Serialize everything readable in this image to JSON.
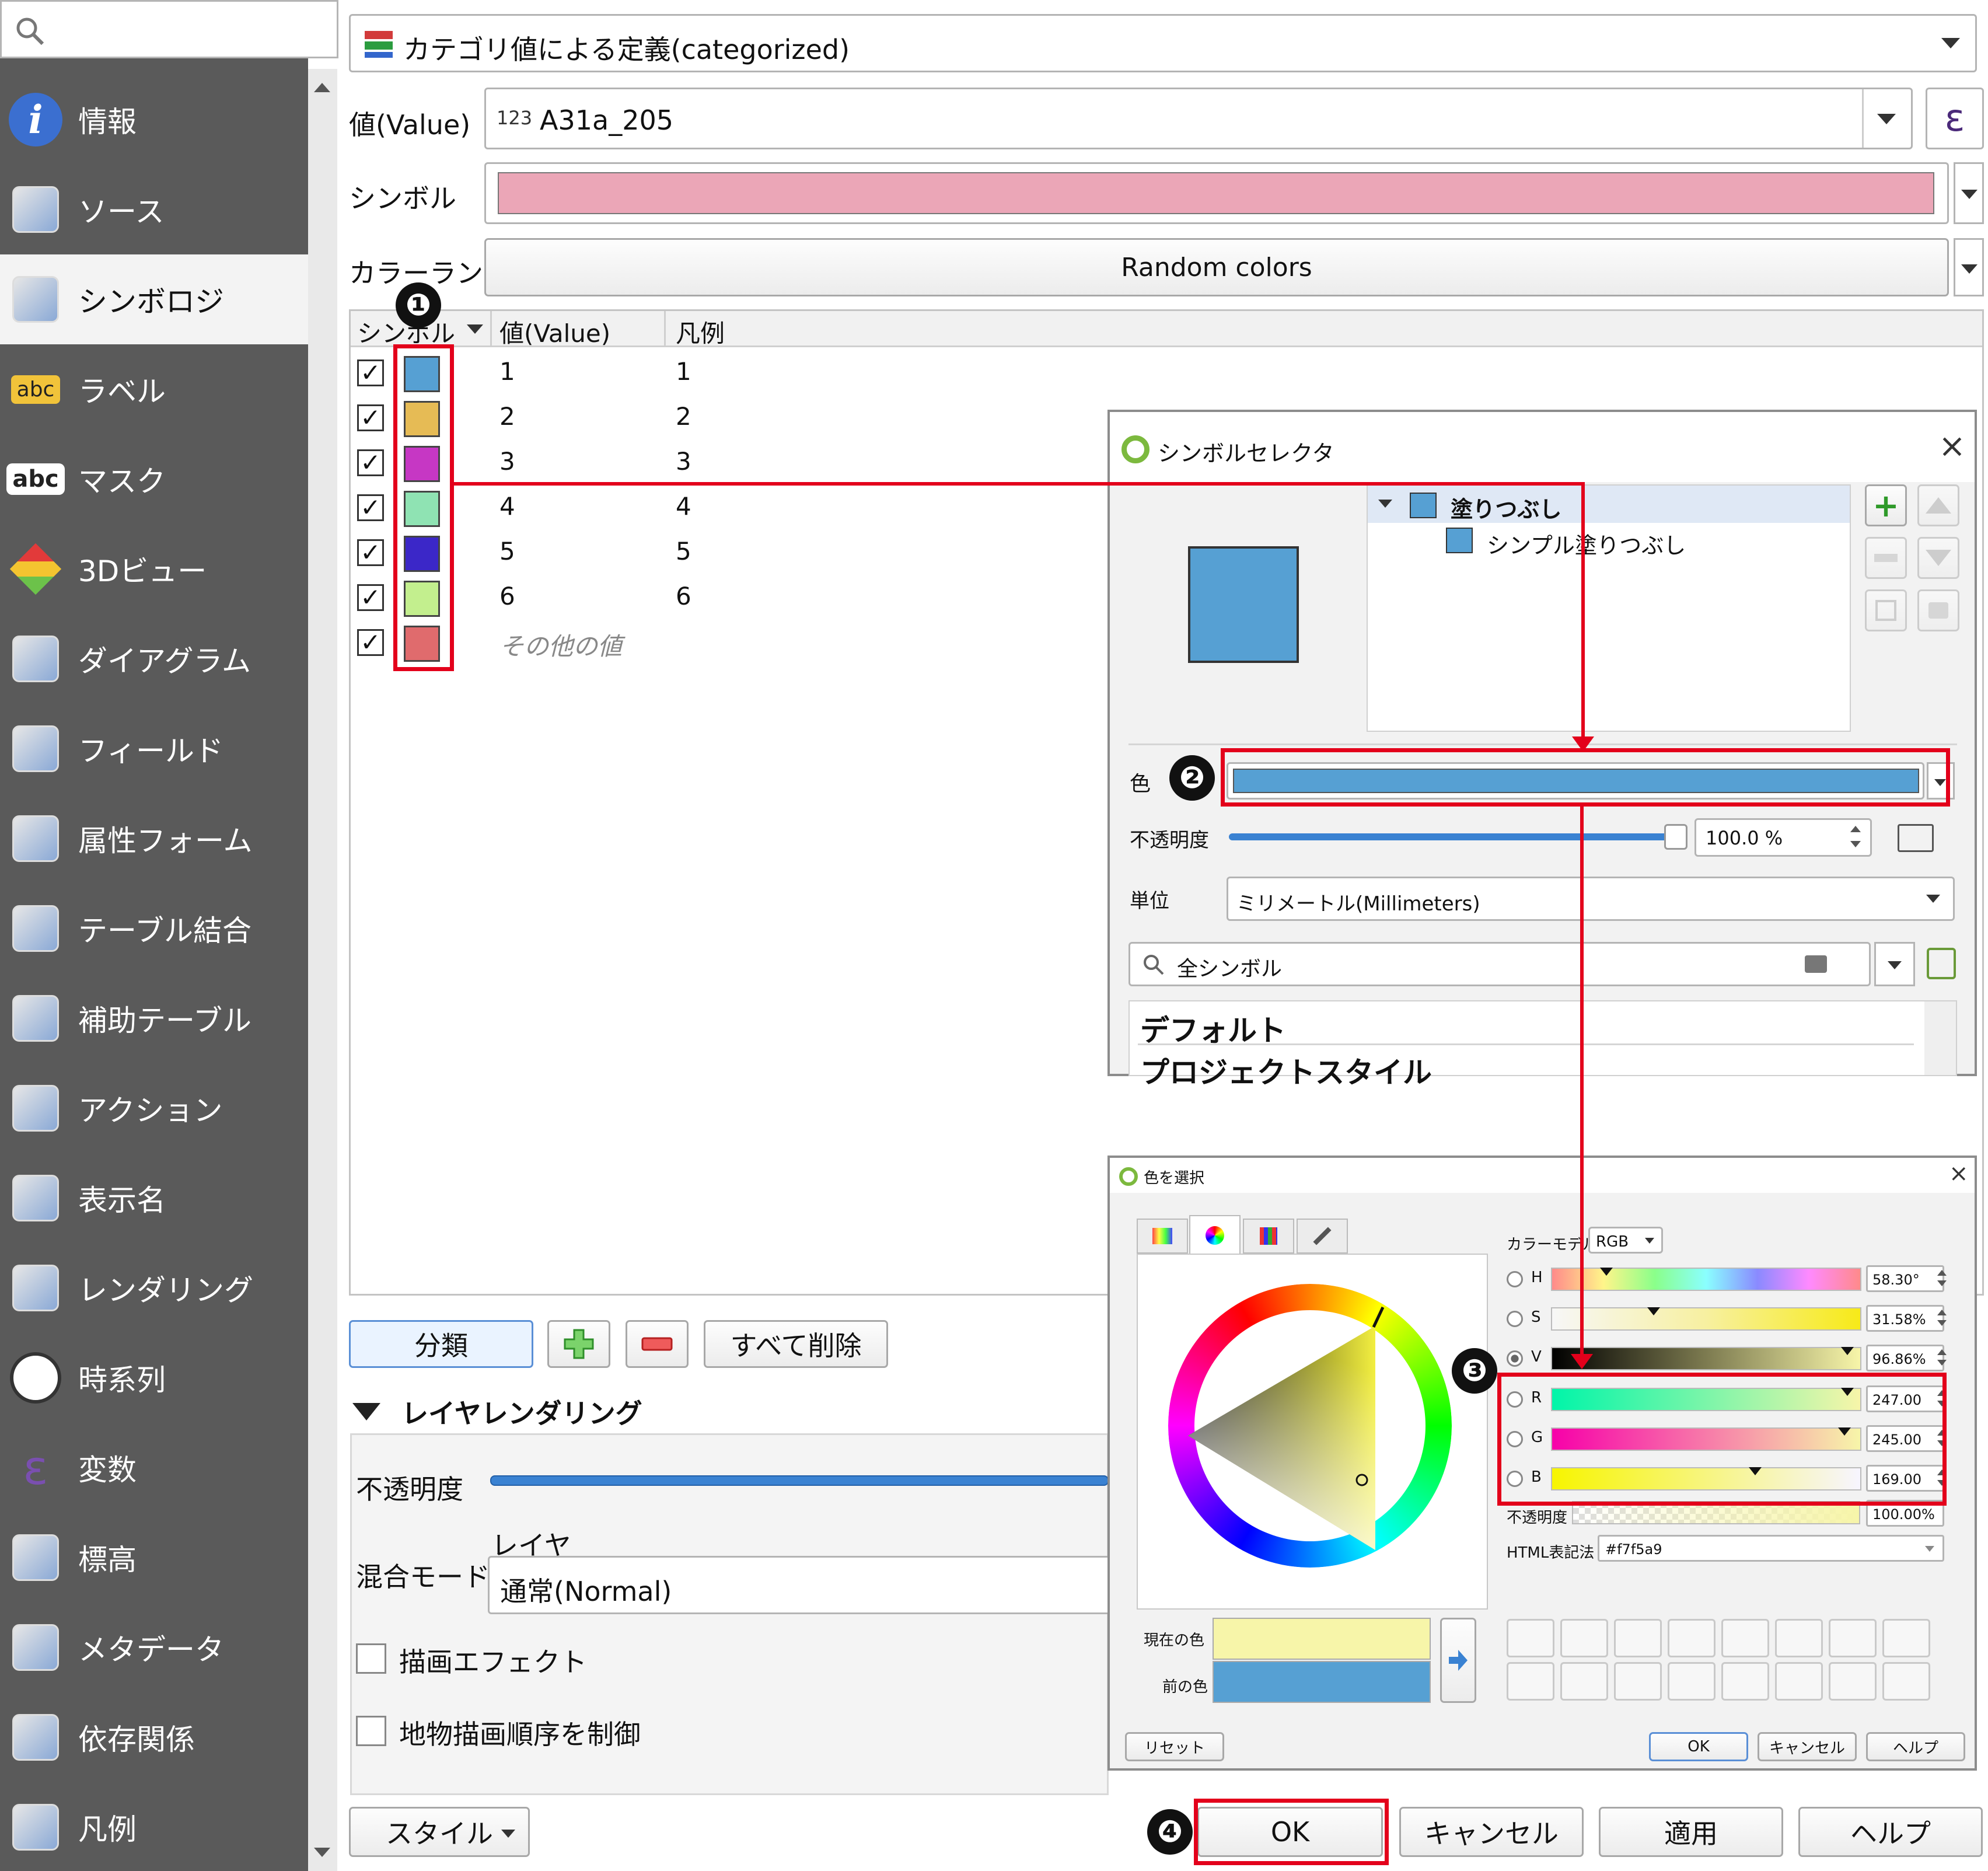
{
  "sidebar": {
    "search_icon": "search-icon",
    "items": [
      {
        "label": "情報",
        "icon": "info-icon"
      },
      {
        "label": "ソース",
        "icon": "source-tools-icon"
      },
      {
        "label": "シンボロジ",
        "icon": "symbology-brush-icon"
      },
      {
        "label": "ラベル",
        "icon": "label-abc-icon"
      },
      {
        "label": "マスク",
        "icon": "mask-abc-icon"
      },
      {
        "label": "3Dビュー",
        "icon": "cube-3d-icon"
      },
      {
        "label": "ダイアグラム",
        "icon": "diagram-icon"
      },
      {
        "label": "フィールド",
        "icon": "fields-icon"
      },
      {
        "label": "属性フォーム",
        "icon": "attribute-form-icon"
      },
      {
        "label": "テーブル結合",
        "icon": "join-icon"
      },
      {
        "label": "補助テーブル",
        "icon": "auxiliary-storage-icon"
      },
      {
        "label": "アクション",
        "icon": "action-gear-icon"
      },
      {
        "label": "表示名",
        "icon": "display-balloon-icon"
      },
      {
        "label": "レンダリング",
        "icon": "rendering-brush-icon"
      },
      {
        "label": "時系列",
        "icon": "clock-icon"
      },
      {
        "label": "変数",
        "icon": "variable-epsilon-icon"
      },
      {
        "label": "標高",
        "icon": "elevation-icon"
      },
      {
        "label": "メタデータ",
        "icon": "metadata-icon"
      },
      {
        "label": "依存関係",
        "icon": "dependencies-icon"
      },
      {
        "label": "凡例",
        "icon": "legend-icon"
      }
    ]
  },
  "renderer": {
    "label": "カテゴリ値による定義(categorized)"
  },
  "value_row": {
    "label": "値(Value)",
    "field_type": "123",
    "field": "A31a_205",
    "epsilon": "ε"
  },
  "symbol_row": {
    "label": "シンボル",
    "color": "#eba6b7"
  },
  "ramp_row": {
    "label": "カラーランプ",
    "value": "Random colors"
  },
  "table": {
    "headers": {
      "symbol": "シンボル",
      "value": "値(Value)",
      "legend": "凡例"
    },
    "rows": [
      {
        "value": "1",
        "legend": "1",
        "color": "#56a0d3",
        "check": "✓"
      },
      {
        "value": "2",
        "legend": "2",
        "color": "#e6bb55",
        "check": "✓"
      },
      {
        "value": "3",
        "legend": "3",
        "color": "#c637c4",
        "check": "✓"
      },
      {
        "value": "4",
        "legend": "4",
        "color": "#8fe3b3",
        "check": "✓"
      },
      {
        "value": "5",
        "legend": "5",
        "color": "#3b27c8",
        "check": "✓"
      },
      {
        "value": "6",
        "legend": "6",
        "color": "#c3ef8e",
        "check": "✓"
      },
      {
        "value": "その他の値",
        "legend": "",
        "color": "#e06b6d",
        "check": "✓"
      }
    ]
  },
  "buttons": {
    "classify": "分類",
    "delete_all": "すべて削除",
    "style": "スタイル",
    "ok": "OK",
    "cancel": "キャンセル",
    "apply": "適用",
    "help": "ヘルプ"
  },
  "layer_rendering": {
    "title": "レイヤレンダリング",
    "opacity_label": "不透明度",
    "blend_label": "混合モード",
    "layer_label": "レイヤ",
    "blend_value": "通常(Normal)",
    "draw_effects": "描画エフェクト",
    "order_by": "地物描画順序を制御"
  },
  "symbol_selector": {
    "title": "シンボルセレクタ",
    "close": "×",
    "preview_color": "#56a0d3",
    "tree": {
      "fill": "塗りつぶし",
      "simple_fill": "シンプル塗りつぶし"
    },
    "color_label": "色",
    "color_value": "#56a0d3",
    "opacity_label": "不透明度",
    "opacity_value": "100.0 %",
    "unit_label": "単位",
    "unit_value": "ミリメートル(Millimeters)",
    "search_placeholder": "全シンボル",
    "styles": [
      "デフォルト",
      "プロジェクトスタイル"
    ]
  },
  "color_dialog": {
    "title": "色を選択",
    "close": "×",
    "color_model_label": "カラーモデル",
    "color_model_value": "RGB",
    "channels": [
      {
        "key": "H",
        "value": "58.30°",
        "level": 0.16
      },
      {
        "key": "S",
        "value": "31.58%",
        "level": 0.32
      },
      {
        "key": "V",
        "value": "96.86%",
        "level": 0.97
      },
      {
        "key": "R",
        "value": "247.00",
        "level": 0.97
      },
      {
        "key": "G",
        "value": "245.00",
        "level": 0.96
      },
      {
        "key": "B",
        "value": "169.00",
        "level": 0.66
      }
    ],
    "opacity_label": "不透明度",
    "opacity_value": "100.00%",
    "html_label": "HTML表記法",
    "html_value": "#f7f5a9",
    "current_label": "現在の色",
    "previous_label": "前の色",
    "current_color": "#f7f5a9",
    "previous_color": "#56a0d3",
    "reset": "リセット",
    "ok": "OK",
    "cancel": "キャンセル",
    "help": "ヘルプ"
  },
  "badges": [
    "❶",
    "❷",
    "❸",
    "❹"
  ],
  "colors": {
    "highlight": "#e3001b",
    "sidebar": "#5a5a5a",
    "accent": "#3a82d2"
  }
}
